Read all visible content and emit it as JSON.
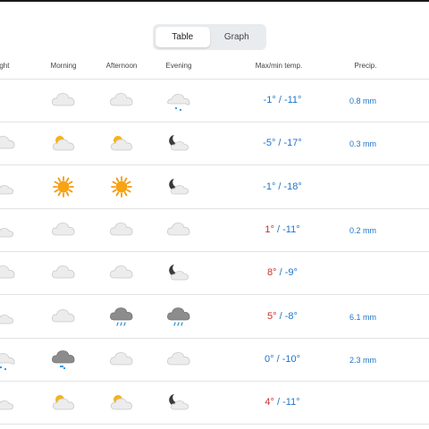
{
  "view_toggle": {
    "table_label": "Table",
    "graph_label": "Graph",
    "active": "table"
  },
  "columns": {
    "night": "ight",
    "morning": "Morning",
    "afternoon": "Afternoon",
    "evening": "Evening",
    "temp": "Max/min temp.",
    "precip": "Precip."
  },
  "rows": [
    {
      "night": "",
      "morning": "cloud",
      "afternoon": "cloud",
      "evening": "cloud-rain-light",
      "max": "-1°",
      "min": "-11°",
      "max_warm": false,
      "precip": "0.8 mm"
    },
    {
      "night": "cloud",
      "morning": "partly-sunny",
      "afternoon": "partly-sunny",
      "evening": "partly-cloudy-night",
      "max": "-5°",
      "min": "-17°",
      "max_warm": false,
      "precip": "0.3 mm"
    },
    {
      "night": "partly-cloudy-night",
      "morning": "sun",
      "afternoon": "sun",
      "evening": "partly-cloudy-night",
      "max": "-1°",
      "min": "-18°",
      "max_warm": false,
      "precip": ""
    },
    {
      "night": "partly-cloudy-night",
      "morning": "cloud",
      "afternoon": "cloud",
      "evening": "cloud",
      "max": "1°",
      "min": "-11°",
      "max_warm": true,
      "precip": "0.2 mm"
    },
    {
      "night": "cloud",
      "morning": "cloud",
      "afternoon": "cloud",
      "evening": "partly-cloudy-night",
      "max": "8°",
      "min": "-9°",
      "max_warm": true,
      "precip": ""
    },
    {
      "night": "partly-cloudy-night",
      "morning": "cloud",
      "afternoon": "cloud-rain",
      "evening": "cloud-rain",
      "max": "5°",
      "min": "-8°",
      "max_warm": true,
      "precip": "6.1 mm"
    },
    {
      "night": "cloud-rain-light",
      "morning": "cloud-rain-dark",
      "afternoon": "cloud",
      "evening": "cloud",
      "max": "0°",
      "min": "-10°",
      "max_warm": false,
      "precip": "2.3 mm"
    },
    {
      "night": "partly-cloudy-night",
      "morning": "partly-sunny",
      "afternoon": "partly-sunny",
      "evening": "partly-cloudy-night",
      "max": "4°",
      "min": "-11°",
      "max_warm": true,
      "precip": ""
    }
  ],
  "colors": {
    "warm": "#c9302c",
    "cold": "#1f73c9",
    "precip": "#1f73c9"
  }
}
